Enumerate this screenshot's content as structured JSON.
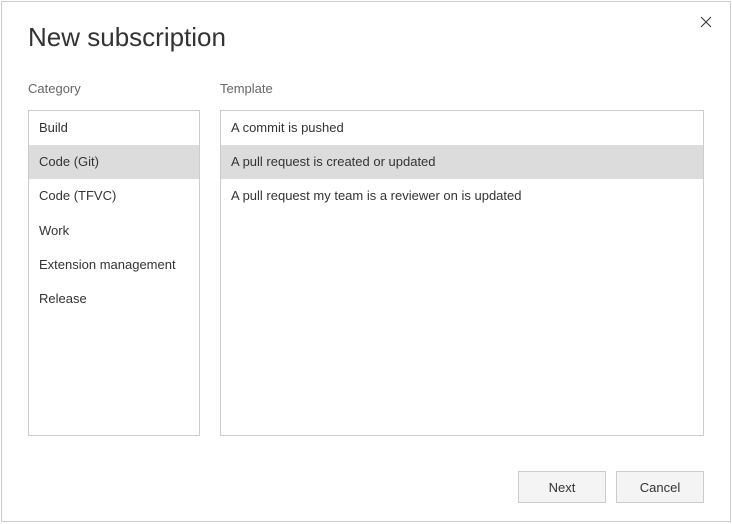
{
  "title": "New subscription",
  "labels": {
    "category": "Category",
    "template": "Template"
  },
  "categories": [
    {
      "label": "Build",
      "selected": false
    },
    {
      "label": "Code (Git)",
      "selected": true
    },
    {
      "label": "Code (TFVC)",
      "selected": false
    },
    {
      "label": "Work",
      "selected": false
    },
    {
      "label": "Extension management",
      "selected": false
    },
    {
      "label": "Release",
      "selected": false
    }
  ],
  "templates": [
    {
      "label": "A commit is pushed",
      "selected": false
    },
    {
      "label": "A pull request is created or updated",
      "selected": true
    },
    {
      "label": "A pull request my team is a reviewer on is updated",
      "selected": false
    }
  ],
  "buttons": {
    "next": "Next",
    "cancel": "Cancel"
  }
}
